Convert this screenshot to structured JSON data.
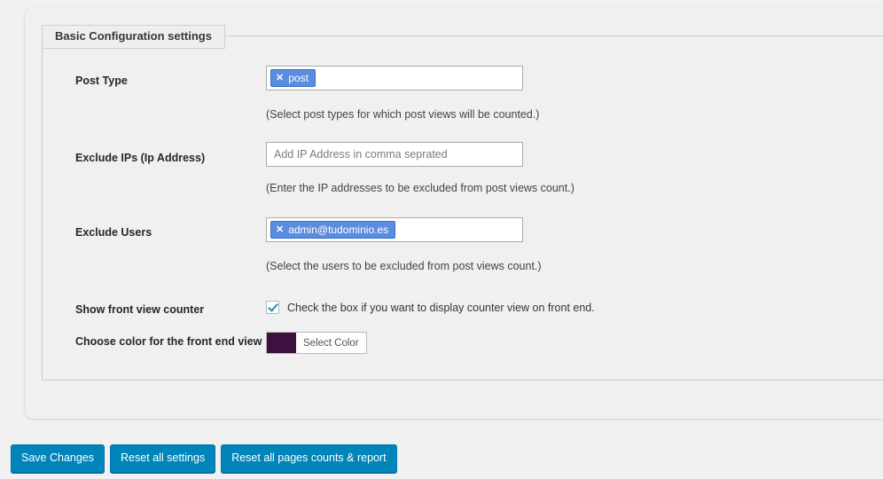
{
  "panel": {
    "legend": "Basic Configuration settings"
  },
  "fields": [
    {
      "label": "Post Type",
      "type": "tags",
      "tags": [
        {
          "text": "post",
          "remove_icon": "close-icon"
        }
      ],
      "help": "(Select post types for which post views will be counted.)"
    },
    {
      "label": "Exclude IPs (Ip Address)",
      "type": "text",
      "value": "",
      "placeholder": "Add IP Address in comma seprated",
      "help": "(Enter the IP addresses to be excluded from post views count.)"
    },
    {
      "label": "Exclude Users",
      "type": "tags",
      "tags": [
        {
          "text": "admin@tudominio.es",
          "remove_icon": "close-icon"
        }
      ],
      "help": "(Select the users to be excluded from post views count.)"
    },
    {
      "label": "Show front view counter",
      "type": "checkbox",
      "checked": true,
      "checkbox_text": "Check the box if you want to display counter view on front end."
    },
    {
      "label": "Choose color for the front end view",
      "type": "color",
      "color": "#3d1040",
      "button_text": "Select Color"
    }
  ],
  "buttons": [
    {
      "label": "Save Changes"
    },
    {
      "label": "Reset all settings"
    },
    {
      "label": "Reset all pages counts & report"
    }
  ],
  "colors": {
    "accent_blue": "#0085ba",
    "chip_blue": "#5a8ce0",
    "swatch_purple": "#3d1040",
    "page_bg": "#f1f1f1"
  }
}
